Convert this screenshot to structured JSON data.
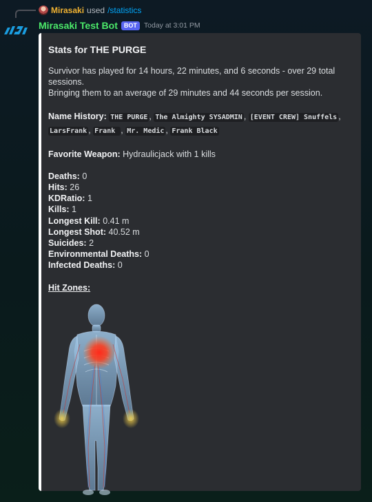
{
  "reply": {
    "user": "Mirasaki",
    "action": "used",
    "command": "/statistics"
  },
  "message": {
    "author": "Mirasaki Test Bot",
    "badge": "BOT",
    "timestamp": "Today at 3:01 PM"
  },
  "embed": {
    "title": "Stats for THE PURGE",
    "summary_line1": "Survivor has played for 14 hours, 22 minutes, and 6 seconds - over 29 total sessions.",
    "summary_line2": "Bringing them to an average of 29 minutes and 44 seconds per session.",
    "name_history_label": "Name History:",
    "name_history": [
      "THE PURGE",
      "The Almighty SYSADMIN",
      "[EVENT CREW] Snuffels",
      "LarsFrank",
      "Frank ",
      "Mr. Medic",
      "Frank Black"
    ],
    "favorite_weapon_label": "Favorite Weapon:",
    "favorite_weapon_value": "Hydraulicjack with 1 kills",
    "stats": [
      {
        "label": "Deaths:",
        "value": "0"
      },
      {
        "label": "Hits:",
        "value": "26"
      },
      {
        "label": "KDRatio:",
        "value": "1"
      },
      {
        "label": "Kills:",
        "value": "1"
      },
      {
        "label": "Longest Kill:",
        "value": "0.41 m"
      },
      {
        "label": "Longest Shot:",
        "value": "40.52 m"
      },
      {
        "label": "Suicides:",
        "value": "2"
      },
      {
        "label": "Environmental Deaths:",
        "value": "0"
      },
      {
        "label": "Infected Deaths:",
        "value": "0"
      }
    ],
    "hit_zones_label": "Hit Zones:"
  },
  "colors": {
    "bot_name": "#4cea6a",
    "badge": "#5865f2",
    "reply_name": "#f0b232",
    "command": "#00a8fc",
    "embed_bg": "#2b2d31",
    "embed_border": "#ffffff"
  }
}
